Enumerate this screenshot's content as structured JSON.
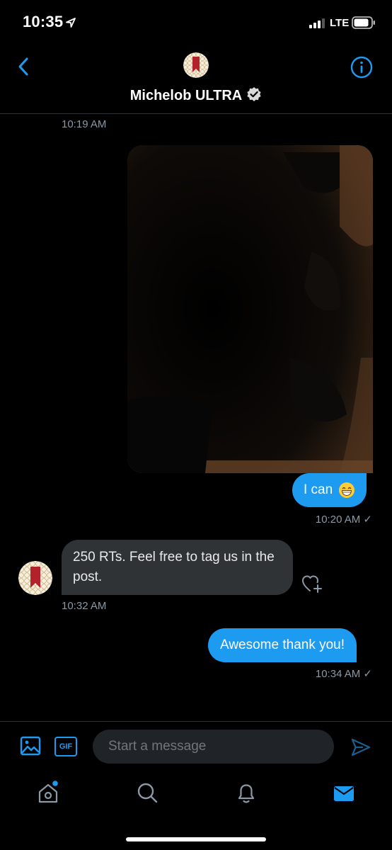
{
  "status_bar": {
    "time": "10:35",
    "network": "LTE"
  },
  "header": {
    "contact_name": "Michelob ULTRA",
    "verified_icon": "verified-badge-icon"
  },
  "messages": {
    "timestamp_1": "10:19 AM",
    "sent_1": {
      "text": "I can",
      "emoji": "grinning-face-with-smiling-eyes",
      "timestamp": "10:20 AM ✓"
    },
    "received_1": {
      "text": "250 RTs. Feel free to tag us in the post.",
      "timestamp": "10:32 AM"
    },
    "sent_2": {
      "text": "Awesome thank you!",
      "timestamp": "10:34 AM ✓"
    }
  },
  "composer": {
    "placeholder": "Start a message",
    "gif_label": "GIF"
  },
  "colors": {
    "accent": "#1d9bf0",
    "bubble_in": "#2f3336",
    "background": "#000000",
    "meta_text": "#8b98a5"
  },
  "bottom_nav": {
    "items": [
      "home-icon",
      "search-icon",
      "notifications-icon",
      "messages-icon"
    ]
  }
}
